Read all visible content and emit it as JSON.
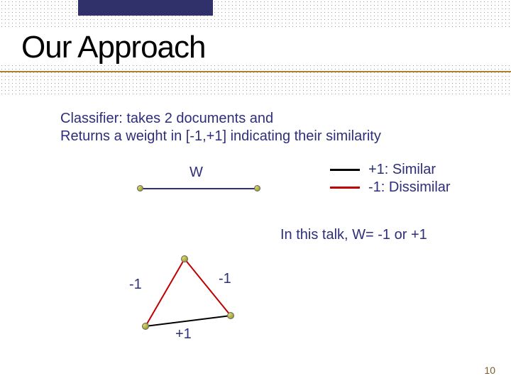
{
  "title": "Our Approach",
  "desc_line1": "Classifier: takes 2 documents and",
  "desc_line2": "Returns a weight in [-1,+1] indicating their similarity",
  "edge_label": "W",
  "legend": {
    "similar": "+1: Similar",
    "dissimilar": " -1: Dissimilar"
  },
  "note": "In this talk, W= -1 or +1",
  "tri": {
    "left": "-1",
    "right": "-1",
    "bottom": "+1"
  },
  "colors": {
    "dissimilar_edge": "#c00000",
    "similar_edge": "#000000"
  },
  "page_number": "10"
}
